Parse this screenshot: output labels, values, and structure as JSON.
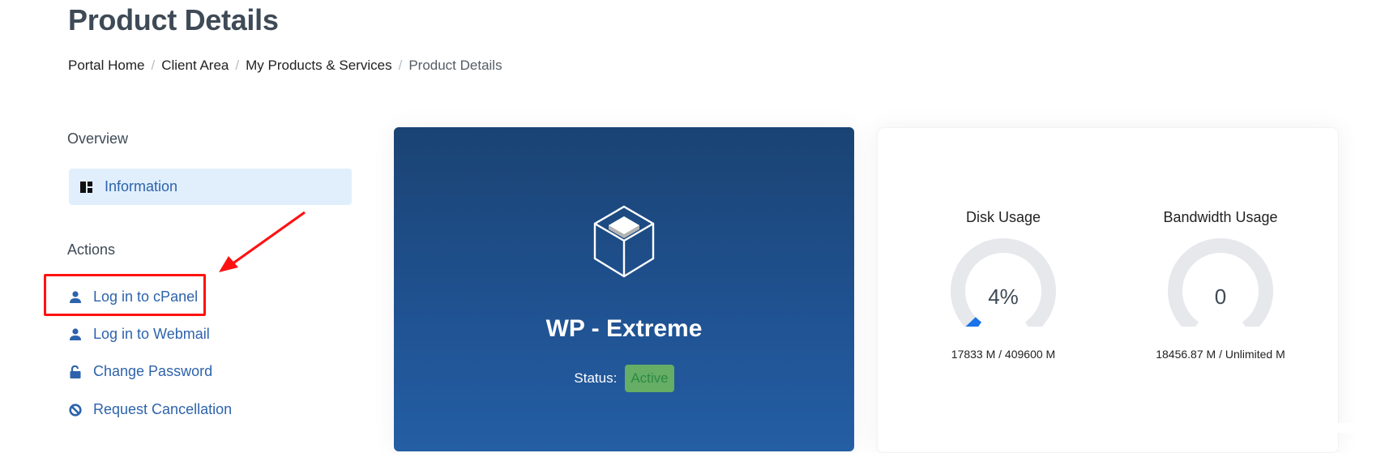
{
  "header": {
    "title": "Product Details",
    "breadcrumb": [
      "Portal Home",
      "Client Area",
      "My Products & Services",
      "Product Details"
    ],
    "breadcrumb_separator": "/"
  },
  "sidebar": {
    "overview_heading": "Overview",
    "overview_items": [
      {
        "label": "Information",
        "icon": "dashboard-icon",
        "active": true
      }
    ],
    "actions_heading": "Actions",
    "actions": [
      {
        "label": "Log in to cPanel",
        "icon": "user-icon",
        "highlighted": true
      },
      {
        "label": "Log in to Webmail",
        "icon": "user-icon"
      },
      {
        "label": "Change Password",
        "icon": "unlock-icon"
      },
      {
        "label": "Request Cancellation",
        "icon": "ban-icon"
      }
    ]
  },
  "product": {
    "icon": "cube-icon",
    "name": "WP - Extreme",
    "status_label": "Status:",
    "status": "Active",
    "status_color": "#66ad65"
  },
  "usage": {
    "disk": {
      "title": "Disk Usage",
      "value_text": "4%",
      "percent": 4,
      "used": "17833 M",
      "limit": "409600 M",
      "detail": "17833 M / 409600 M",
      "color": "#1a73e8"
    },
    "bandwidth": {
      "title": "Bandwidth Usage",
      "value_text": "0",
      "percent": 0,
      "used": "18456.87 M",
      "limit": "Unlimited M",
      "detail": "18456.87 M / Unlimited M",
      "color": "#1a73e8"
    },
    "track_color": "#e6e8ec"
  },
  "annotation": {
    "color": "#ff1111",
    "target": "Log in to cPanel"
  }
}
